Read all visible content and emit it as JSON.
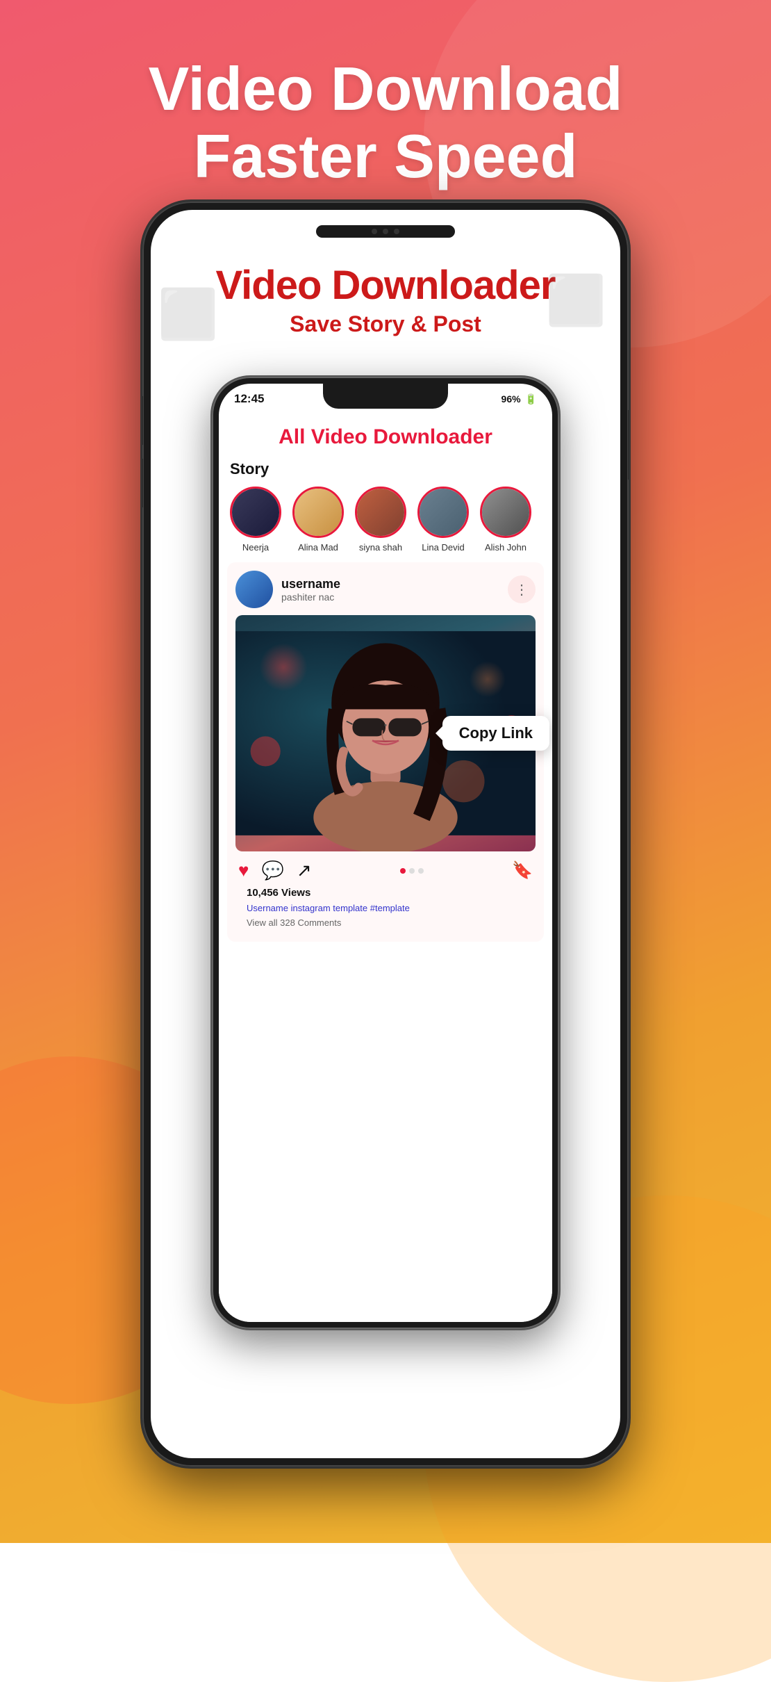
{
  "header": {
    "title_line1": "Video Download",
    "title_line2": "Faster Speed"
  },
  "app": {
    "title": "Video Downloader",
    "subtitle": "Save Story & Post"
  },
  "inner_app": {
    "title_regular": "All Video ",
    "title_colored": "Downloader"
  },
  "status_bar": {
    "time": "12:45",
    "battery": "96%",
    "battery_icon": "🔋"
  },
  "story": {
    "label": "Story",
    "items": [
      {
        "name": "Neerja",
        "color": "avatar-1"
      },
      {
        "name": "Alina Mad",
        "color": "avatar-2"
      },
      {
        "name": "siyna shah",
        "color": "avatar-3"
      },
      {
        "name": "Lina Devid",
        "color": "avatar-4"
      },
      {
        "name": "Alish John",
        "color": "avatar-5"
      }
    ]
  },
  "post": {
    "username": "username",
    "subtitle": "pashiter nac",
    "views": "10,456 Views",
    "caption": "Username instagram template #template",
    "comments": "View all 328 Comments",
    "copy_link_label": "Copy Link"
  }
}
